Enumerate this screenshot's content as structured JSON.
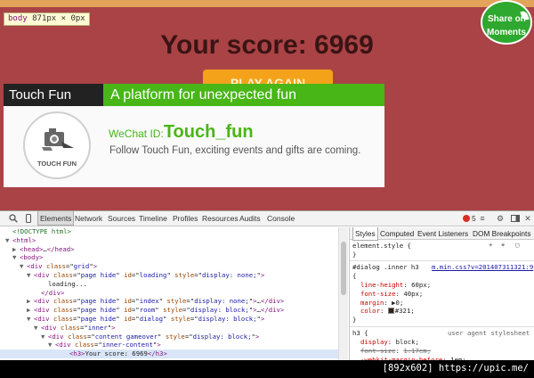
{
  "page": {
    "inspect_tip_tag": "body",
    "inspect_tip_size": "871px × 0px",
    "score_text": "Your score: 6969",
    "play_again_label": "PLAY AGAIN",
    "share": {
      "line1": "Share on",
      "line2": "Moments"
    },
    "dialog": {
      "brand": "Touch Fun",
      "tagline": "A platform for unexpected fun",
      "logo_text": "TOUCH FUN",
      "wechat_label": "WeChat ID:",
      "wechat_id": "Touch_fun",
      "follow_text": "Follow Touch Fun, exciting events and gifts are coming."
    }
  },
  "devtools": {
    "tabs": [
      "Elements",
      "Network",
      "Sources",
      "Timeline",
      "Profiles",
      "Resources",
      "Audits",
      "Console"
    ],
    "active_tab": "Elements",
    "error_count": "5",
    "dom_lines": [
      {
        "indent": 0,
        "html": "<span class='cm'>&lt;!DOCTYPE html&gt;</span>"
      },
      {
        "indent": 0,
        "tri": "▼",
        "html": "<span class='tag'>&lt;html&gt;</span>"
      },
      {
        "indent": 1,
        "tri": "▶",
        "html": "<span class='tag'>&lt;head&gt;</span>…<span class='tag'>&lt;/head&gt;</span>"
      },
      {
        "indent": 1,
        "tri": "▼",
        "html": "<span class='tag'>&lt;body&gt;</span>"
      },
      {
        "indent": 2,
        "tri": "▼",
        "html": "<span class='tag'>&lt;div</span> <span class='an'>class</span>=\"<span class='av'>grid</span>\"<span class='tag'>&gt;</span>"
      },
      {
        "indent": 3,
        "tri": "▼",
        "html": "<span class='tag'>&lt;div</span> <span class='an'>class</span>=\"<span class='av'>page hide</span>\" <span class='an'>id</span>=\"<span class='av'>loading</span>\" <span class='an'>style</span>=\"<span class='av'>display: none;</span>\"<span class='tag'>&gt;</span>"
      },
      {
        "indent": 5,
        "html": "loading..."
      },
      {
        "indent": 4,
        "html": "<span class='tag'>&lt;/div&gt;</span>"
      },
      {
        "indent": 3,
        "tri": "▶",
        "html": "<span class='tag'>&lt;div</span> <span class='an'>class</span>=\"<span class='av'>page hide</span>\" <span class='an'>id</span>=\"<span class='av'>index</span>\" <span class='an'>style</span>=\"<span class='av'>display: none;</span>\"<span class='tag'>&gt;</span>…<span class='tag'>&lt;/div&gt;</span>"
      },
      {
        "indent": 3,
        "tri": "▶",
        "html": "<span class='tag'>&lt;div</span> <span class='an'>class</span>=\"<span class='av'>page hide</span>\" <span class='an'>id</span>=\"<span class='av'>room</span>\" <span class='an'>style</span>=\"<span class='av'>display: block;</span>\"<span class='tag'>&gt;</span>…<span class='tag'>&lt;/div&gt;</span>"
      },
      {
        "indent": 3,
        "tri": "▼",
        "html": "<span class='tag'>&lt;div</span> <span class='an'>class</span>=\"<span class='av'>page hide</span>\" <span class='an'>id</span>=\"<span class='av'>dialog</span>\" <span class='an'>style</span>=\"<span class='av'>display: block;</span>\"<span class='tag'>&gt;</span>"
      },
      {
        "indent": 4,
        "tri": "▼",
        "html": "<span class='tag'>&lt;div</span> <span class='an'>class</span>=\"<span class='av'>inner</span>\"<span class='tag'>&gt;</span>"
      },
      {
        "indent": 5,
        "tri": "▼",
        "html": "<span class='tag'>&lt;div</span> <span class='an'>class</span>=\"<span class='av'>content gameover</span>\" <span class='an'>style</span>=\"<span class='av'>display: block;</span>\"<span class='tag'>&gt;</span>"
      },
      {
        "indent": 6,
        "tri": "▼",
        "html": "<span class='tag'>&lt;div</span> <span class='an'>class</span>=\"<span class='av'>inner-content</span>\"<span class='tag'>&gt;</span>"
      },
      {
        "indent": 7,
        "sel": true,
        "html": "<span class='tag'>&lt;h3&gt;</span>Your score: 6969<span class='tag'>&lt;/h3&gt;</span>"
      }
    ],
    "styles_tabs": [
      "Styles",
      "Computed",
      "Event Listeners",
      "DOM Breakpoints"
    ],
    "element_style": "element.style {",
    "rule1": {
      "selector": "#dialog .inner h3",
      "source": "m.min.css?v=201407311321:9",
      "props": [
        {
          "name": "line-height",
          "value": "60px;"
        },
        {
          "name": "font-size",
          "value": "40px;"
        },
        {
          "name": "margin",
          "value": "▶0;"
        },
        {
          "name": "color",
          "value": "#321;",
          "swatch": "#332211"
        }
      ]
    },
    "rule2": {
      "selector": "h3 {",
      "source": "user agent stylesheet",
      "props": [
        {
          "name": "display",
          "value": "block;"
        },
        {
          "name": "font-size",
          "value": "1.17em;",
          "strike": true
        },
        {
          "name": "-webkit-margin-before",
          "value": "1em;"
        }
      ]
    }
  },
  "footer": {
    "text": "[892x602] https://upic.me/"
  }
}
